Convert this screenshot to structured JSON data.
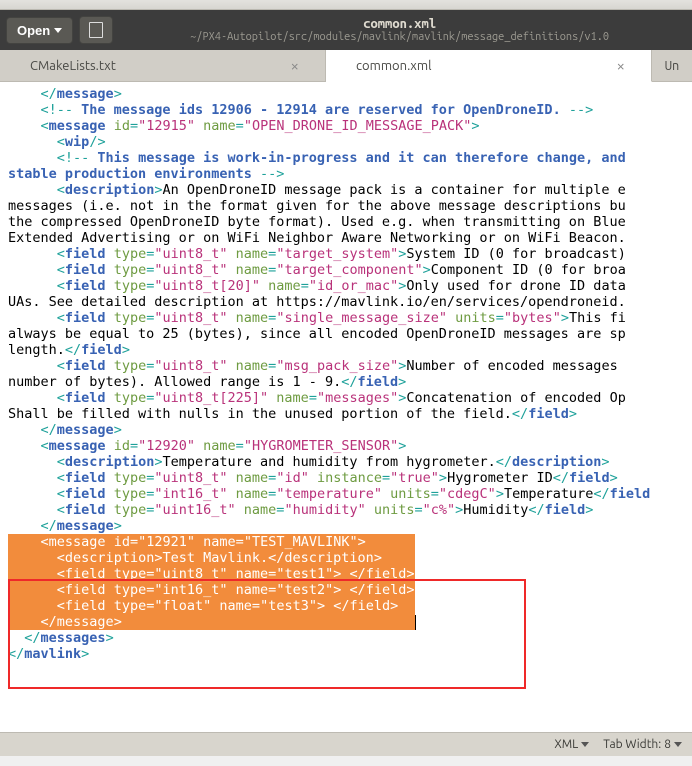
{
  "title_bar": {
    "open_label": "Open",
    "title": "common.xml",
    "subtitle": "~/PX4-Autopilot/src/modules/mavlink/mavlink/message_definitions/v1.0"
  },
  "tabs": [
    {
      "label": "CMakeLists.txt"
    },
    {
      "label": "common.xml"
    },
    {
      "label": "Un"
    }
  ],
  "status": {
    "lang": "XML",
    "tab_width_label": "Tab Width:",
    "tab_width_value": "8"
  },
  "code": {
    "l1_close_msg": "</message>",
    "l2_comment_open": "<!--",
    "l2_comment_text": " The message ids 12906 - 12914 are reserved for OpenDroneID. ",
    "l2_comment_close": "-->",
    "l3_msg1_id": "\"12915\"",
    "l3_msg1_name": "\"OPEN_DRONE_ID_MESSAGE_PACK\"",
    "l4_wip": "<wip/>",
    "l5_comment_open": "<!--",
    "l5_comment_text1": " This message is work-in-progress and it can therefore change, and",
    "l6_comment_text2": "stable production environments ",
    "l6_comment_close": "-->",
    "l7_desc_text": "An OpenDroneID message pack is a container for multiple e",
    "l8_desc_cont": "messages (i.e. not in the format given for the above message descriptions bu",
    "l9_desc_cont": "the compressed OpenDroneID byte format). Used e.g. when transmitting on Blue",
    "l10_desc_cont": "Extended Advertising or on WiFi Neighbor Aware Networking or on WiFi Beacon.",
    "f1_type": "\"uint8_t\"",
    "f1_name": "\"target_system\"",
    "f1_text": "System ID (0 for broadcast)",
    "f2_type": "\"uint8_t\"",
    "f2_name": "\"target_component\"",
    "f2_text": "Component ID (0 for broa",
    "f3_type": "\"uint8_t[20]\"",
    "f3_name": "\"id_or_mac\"",
    "f3_text": "Only used for drone ID data",
    "line_ua": "UAs. See detailed description at https://mavlink.io/en/services/opendroneid.",
    "f4_type": "\"uint8_t\"",
    "f4_name": "\"single_message_size\"",
    "f4_units": "\"bytes\"",
    "f4_text": "This fi",
    "line_always": "always be equal to 25 (bytes), since all encoded OpenDroneID messages are sp",
    "line_length": "length.",
    "f5_type": "\"uint8_t\"",
    "f5_name": "\"msg_pack_size\"",
    "f5_text": "Number of encoded messages ",
    "line_number": "number of bytes). Allowed range is 1 - 9.",
    "f6_type": "\"uint8_t[225]\"",
    "f6_name": "\"messages\"",
    "f6_text": "Concatenation of encoded Op",
    "line_shall": "Shall be filled with nulls in the unused portion of the field.",
    "msg2_id": "\"12920\"",
    "msg2_name": "\"HYGROMETER_SENSOR\"",
    "msg2_desc": "Temperature and humidity from hygrometer.",
    "h1_type": "\"uint8_t\"",
    "h1_name": "\"id\"",
    "h1_inst": "\"true\"",
    "h1_text": "Hygrometer ID",
    "h2_type": "\"int16_t\"",
    "h2_name": "\"temperature\"",
    "h2_units": "\"cdegC\"",
    "h2_text": "Temperature",
    "h3_type": "\"uint16_t\"",
    "h3_name": "\"humidity\"",
    "h3_units": "\"c%\"",
    "h3_text": "Humidity",
    "msg3_id": "\"12921\"",
    "msg3_name": "\"TEST_MAVLINK\"",
    "msg3_desc": "Test Mavlink.",
    "t1_type": "\"uint8_t\"",
    "t1_name": "\"test1\"",
    "t2_type": "\"int16_t\"",
    "t2_name": "\"test2\"",
    "t3_type": "\"float\"",
    "t3_name": "\"test3\"",
    "tag_message": "message",
    "tag_description": "description",
    "tag_field": "field",
    "tag_wip": "wip",
    "tag_messages": "messages",
    "tag_mavlink": "mavlink",
    "attr_id": "id",
    "attr_name": "name",
    "attr_type": "type",
    "attr_units": "units",
    "attr_instance": "instance"
  }
}
